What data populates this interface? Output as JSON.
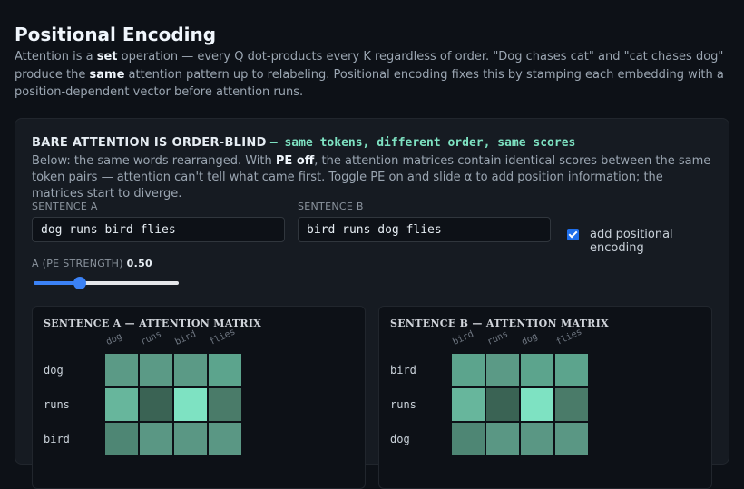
{
  "header": {
    "title": "Positional Encoding",
    "intro_parts": [
      {
        "t": "Attention is a ",
        "b": false
      },
      {
        "t": "set",
        "b": true
      },
      {
        "t": " operation — every Q dot-products every K regardless of order. \"Dog chases cat\" and \"cat chases dog\" produce the ",
        "b": false
      },
      {
        "t": "same",
        "b": true
      },
      {
        "t": " attention pattern up to relabeling. Positional encoding fixes this by stamping each embedding with a position-dependent vector before attention runs.",
        "b": false
      }
    ]
  },
  "card": {
    "heading": "BARE ATTENTION IS ORDER-BLIND",
    "heading_sub": "— same tokens, different order, same scores",
    "desc_parts": [
      {
        "t": "Below: the same words rearranged. With ",
        "b": false
      },
      {
        "t": "PE off",
        "b": true
      },
      {
        "t": ", the attention matrices contain identical scores between the same token pairs — attention can't tell what came first. Toggle PE on and slide α to add position information; the matrices start to diverge.",
        "b": false
      }
    ],
    "sentence_a_label": "SENTENCE A",
    "sentence_a_value": "dog runs bird flies",
    "sentence_b_label": "SENTENCE B",
    "sentence_b_value": "bird runs dog flies",
    "pe_toggle_label": "add positional encoding",
    "pe_enabled": true,
    "alpha_label": "Α (PE STRENGTH)",
    "alpha_value_text": "0.50",
    "alpha_fraction": 0.3
  },
  "colors": {
    "accent": "#3b82f6",
    "heading_accent": "#7ee2c2"
  },
  "matrix_a": {
    "title": "SENTENCE A — ATTENTION MATRIX",
    "tokens": [
      "dog",
      "runs",
      "bird",
      "flies"
    ],
    "rows_visible": 3,
    "cells": [
      [
        "#5b9a86",
        "#5b9a86",
        "#5b9a86",
        "#5ca48d"
      ],
      [
        "#67b69c",
        "#3a6354",
        "#7ee2c2",
        "#4a7b69"
      ],
      [
        "#4e8674",
        "#5a9784",
        "#5a9784",
        "#5a9784"
      ]
    ]
  },
  "matrix_b": {
    "title": "SENTENCE B — ATTENTION MATRIX",
    "tokens": [
      "bird",
      "runs",
      "dog",
      "flies"
    ],
    "rows_visible": 3,
    "cells": [
      [
        "#5ca48d",
        "#5b9a86",
        "#5ca48d",
        "#5ca48d"
      ],
      [
        "#67b69c",
        "#3a6354",
        "#7ee2c2",
        "#4a7b69"
      ],
      [
        "#4e8674",
        "#5a9784",
        "#5a9784",
        "#5a9784"
      ]
    ]
  }
}
